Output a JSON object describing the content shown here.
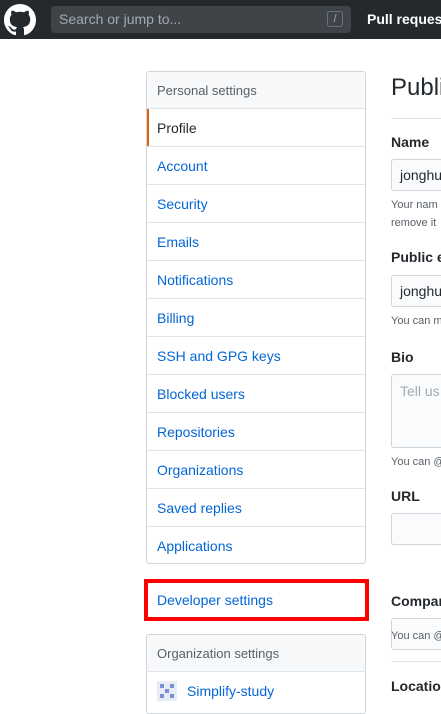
{
  "header": {
    "search_placeholder": "Search or jump to...",
    "slash_key": "/",
    "nav_pull_requests": "Pull requests"
  },
  "personal_settings": {
    "heading": "Personal settings",
    "items": [
      {
        "label": "Profile",
        "selected": true
      },
      {
        "label": "Account"
      },
      {
        "label": "Security"
      },
      {
        "label": "Emails"
      },
      {
        "label": "Notifications"
      },
      {
        "label": "Billing"
      },
      {
        "label": "SSH and GPG keys"
      },
      {
        "label": "Blocked users"
      },
      {
        "label": "Repositories"
      },
      {
        "label": "Organizations"
      },
      {
        "label": "Saved replies"
      },
      {
        "label": "Applications"
      }
    ]
  },
  "developer_settings": {
    "label": "Developer settings"
  },
  "organization_settings": {
    "heading": "Organization settings",
    "items": [
      {
        "label": "Simplify-study"
      }
    ]
  },
  "profile_form": {
    "title": "Publi",
    "name_label": "Name",
    "name_value": "jonghu",
    "name_note_line1": "Your nam",
    "name_note_line2": "remove it",
    "public_email_label": "Public e",
    "public_email_value": "jonghu",
    "public_email_note": "You can m",
    "bio_label": "Bio",
    "bio_placeholder": "Tell us",
    "bio_note": "You can @",
    "url_label": "URL",
    "company_label": "Compar",
    "company_note": "You can @",
    "location_label": "Location"
  },
  "colors": {
    "header_bg": "#24292e",
    "link": "#0366d6",
    "selected_indicator": "#e36209",
    "highlight_box": "#ff0000"
  }
}
